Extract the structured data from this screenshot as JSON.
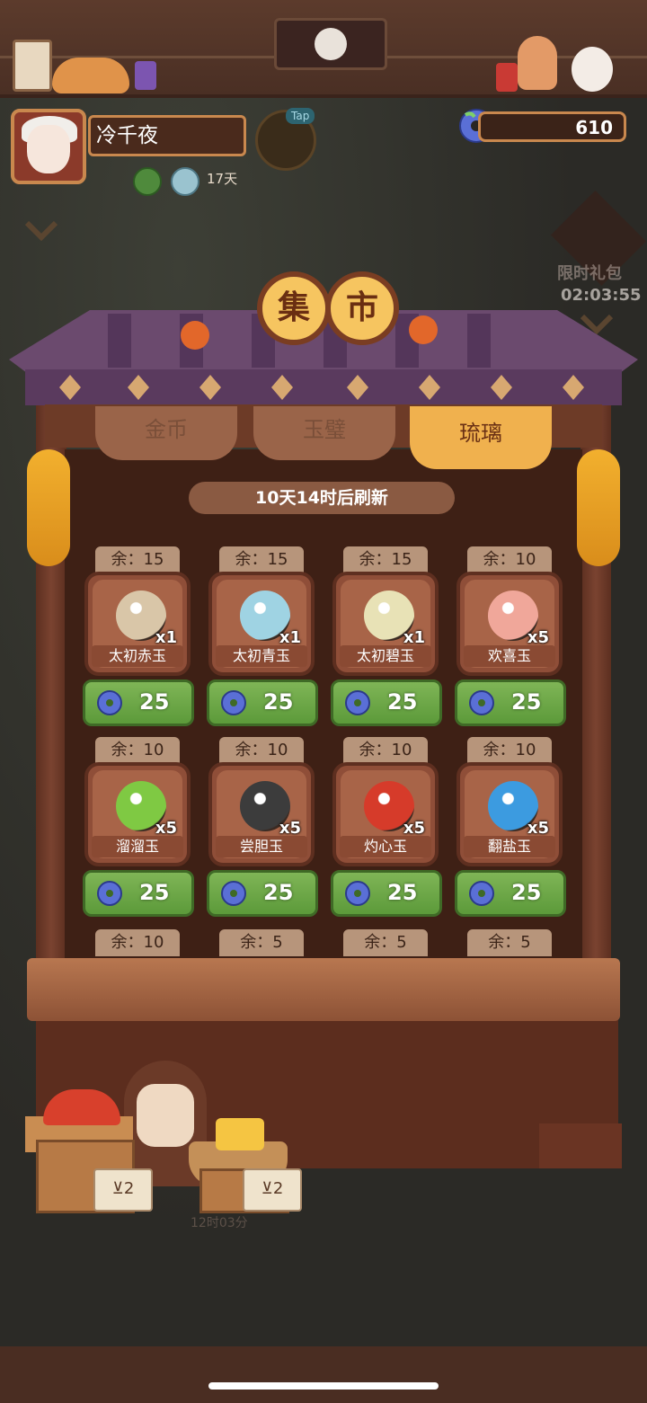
{
  "player": {
    "name": "冷千夜",
    "days": "17天"
  },
  "tap_label": "Tap",
  "currency": {
    "amount": "610",
    "icon": "jade-disc-icon"
  },
  "promo": {
    "label": "限时礼包",
    "timer": "02:03:55"
  },
  "market": {
    "title_chars": [
      "集",
      "市"
    ],
    "tabs": [
      {
        "label": "金币",
        "active": false
      },
      {
        "label": "玉璧",
        "active": false
      },
      {
        "label": "琉璃",
        "active": true
      }
    ],
    "refresh_text": "10天14时后刷新",
    "items": [
      {
        "stock": "余：15",
        "name": "太初赤玉",
        "qty": "x1",
        "price": "25",
        "color": "#d9c6a8"
      },
      {
        "stock": "余：15",
        "name": "太初青玉",
        "qty": "x1",
        "price": "25",
        "color": "#9fd3e3"
      },
      {
        "stock": "余：15",
        "name": "太初碧玉",
        "qty": "x1",
        "price": "25",
        "color": "#e8e2b6"
      },
      {
        "stock": "余：10",
        "name": "欢喜玉",
        "qty": "x5",
        "price": "25",
        "color": "#f0a79a"
      },
      {
        "stock": "余：10",
        "name": "溜溜玉",
        "qty": "x5",
        "price": "25",
        "color": "#7fc943"
      },
      {
        "stock": "余：10",
        "name": "尝胆玉",
        "qty": "x5",
        "price": "25",
        "color": "#3c3c3c"
      },
      {
        "stock": "余：10",
        "name": "灼心玉",
        "qty": "x5",
        "price": "25",
        "color": "#d63b2a"
      },
      {
        "stock": "余：10",
        "name": "翻盐玉",
        "qty": "x5",
        "price": "25",
        "color": "#3c9be0"
      }
    ],
    "partial_row": [
      "余：10",
      "余：5",
      "余：5",
      "余：5"
    ]
  },
  "vendor_tags": [
    "⊻2",
    "⊻2"
  ],
  "vendor_time": "12时03分"
}
